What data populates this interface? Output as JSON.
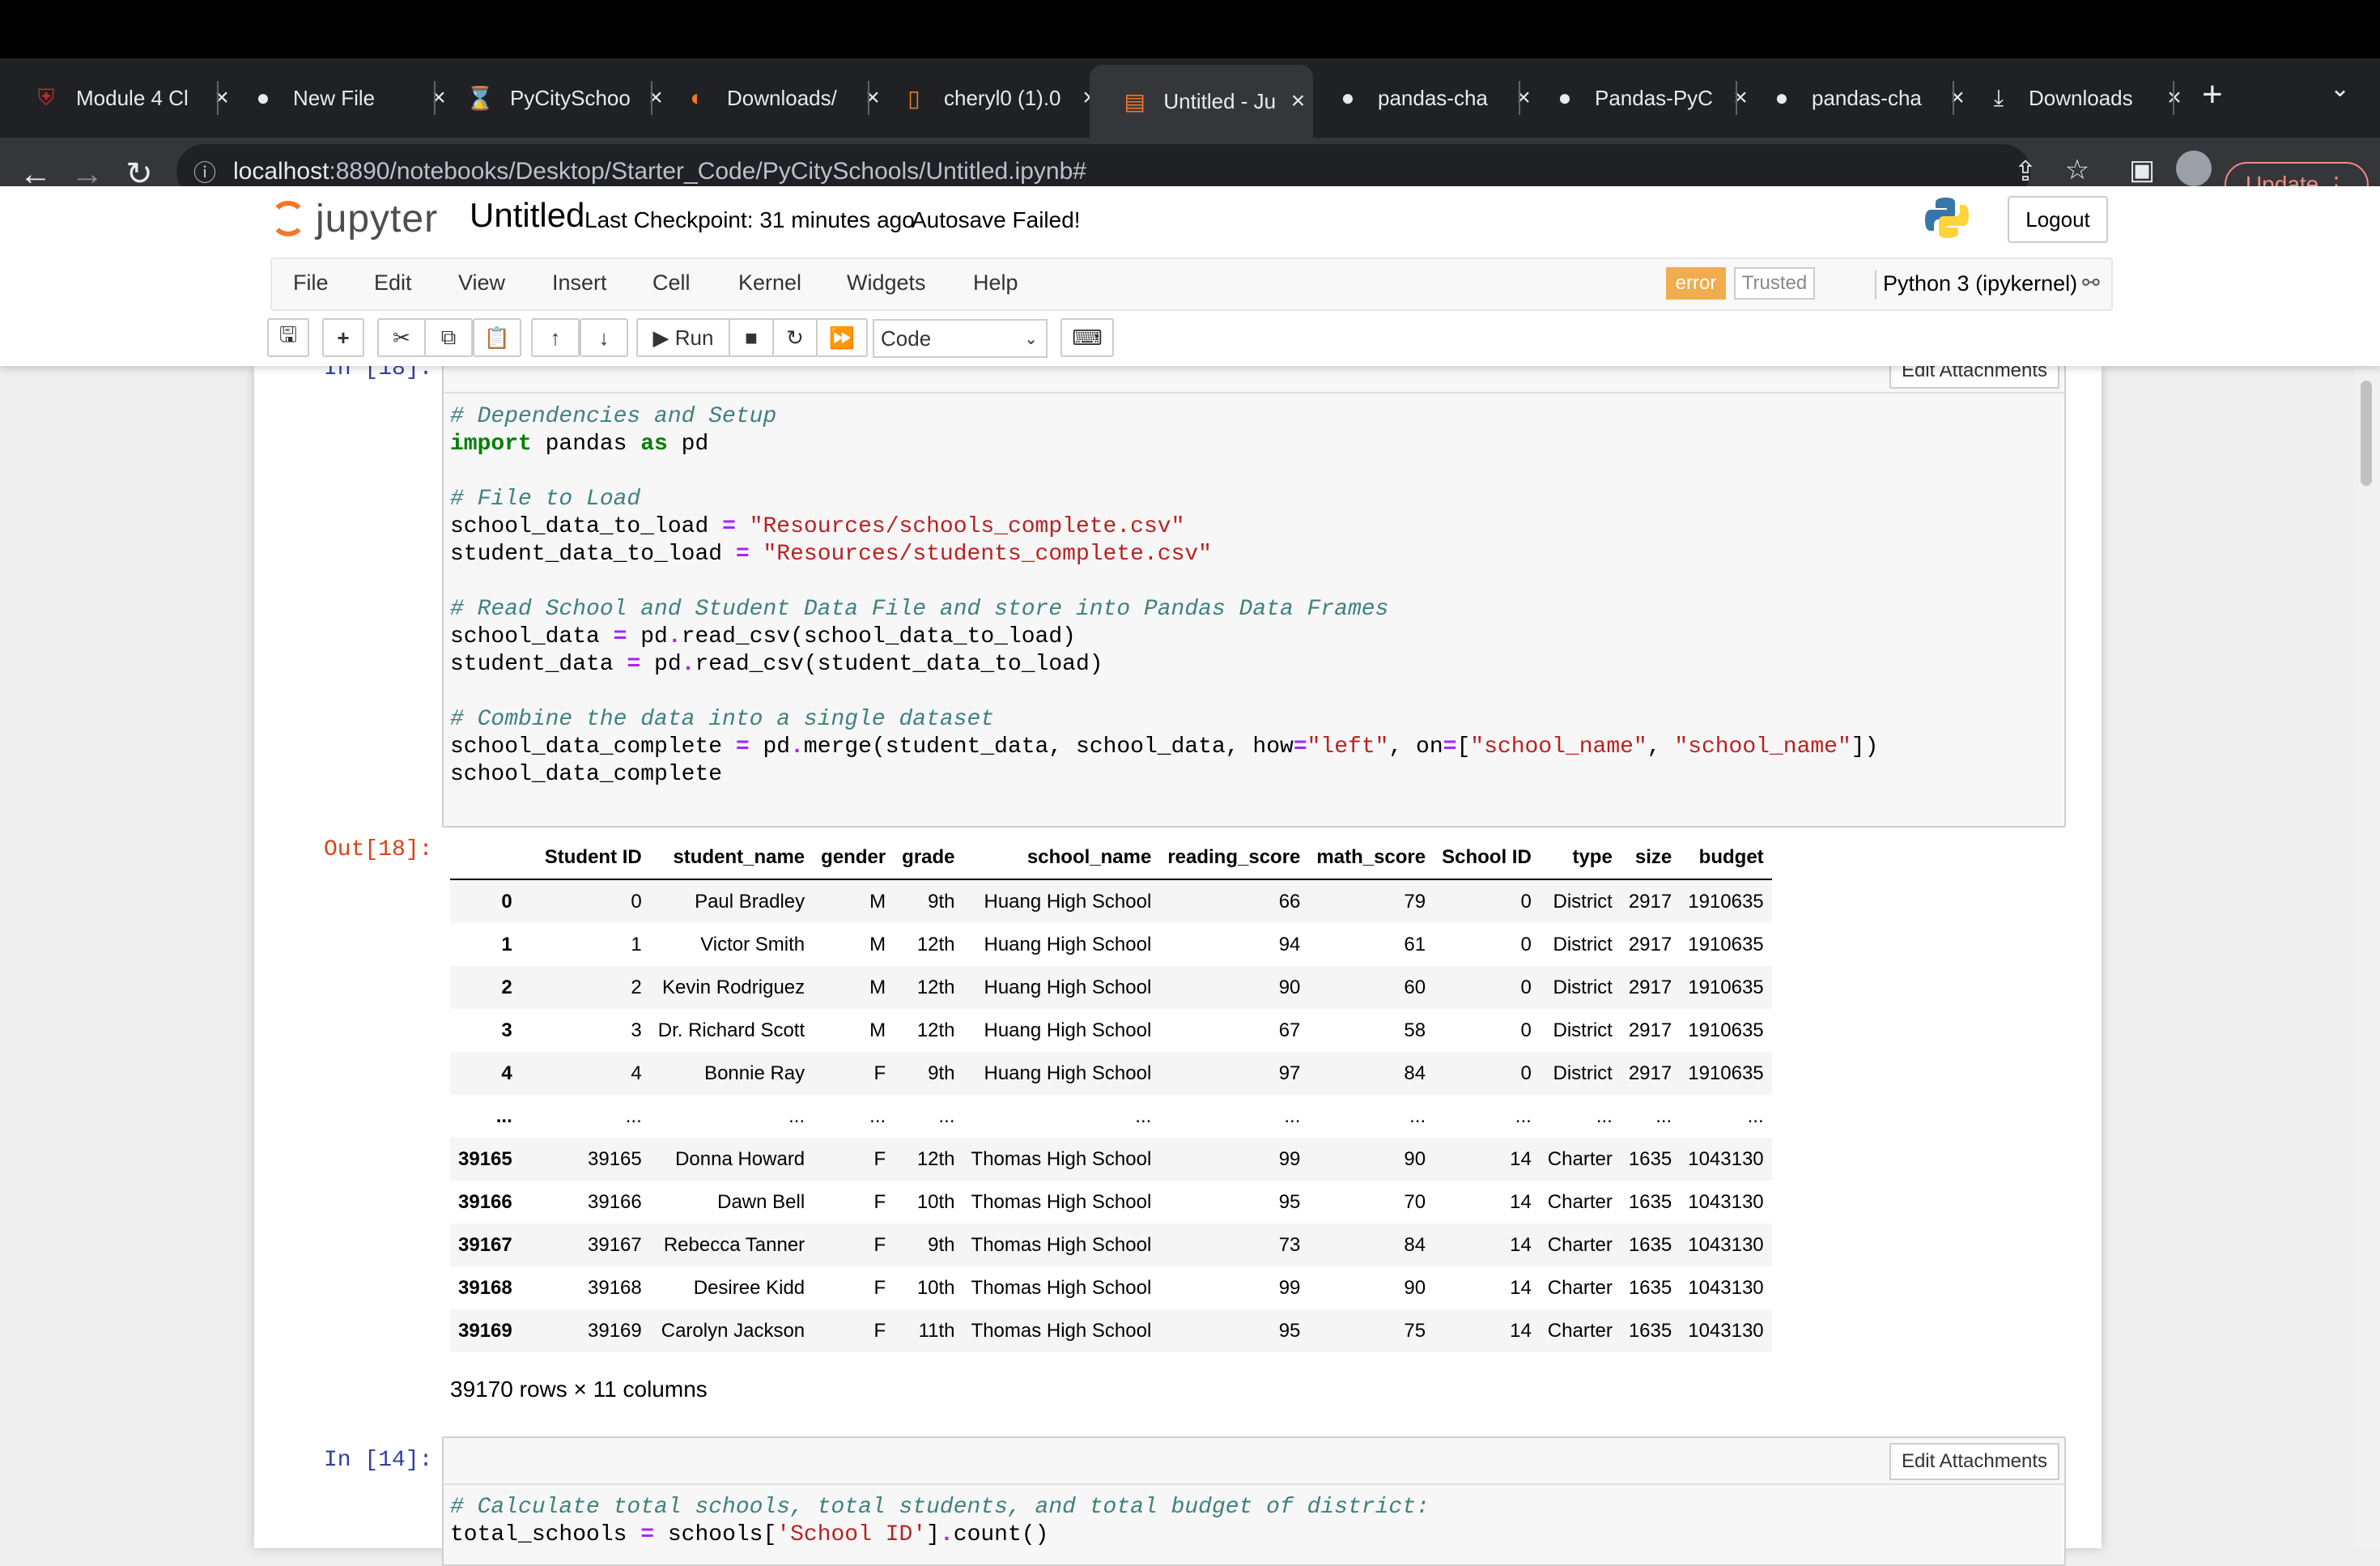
{
  "browser": {
    "tabs": [
      {
        "title": "Module 4 Cl",
        "icon": "shield-icon"
      },
      {
        "title": "New File",
        "icon": "github-icon"
      },
      {
        "title": "PyCitySchoo",
        "icon": "hourglass-icon"
      },
      {
        "title": "Downloads/",
        "icon": "jupyter-icon"
      },
      {
        "title": "cheryl0 (1).0",
        "icon": "file-icon"
      },
      {
        "title": "Untitled - Ju",
        "icon": "notebook-icon"
      },
      {
        "title": "pandas-cha",
        "icon": "github-icon"
      },
      {
        "title": "Pandas-PyC",
        "icon": "github-icon"
      },
      {
        "title": "pandas-cha",
        "icon": "github-icon"
      },
      {
        "title": "Downloads",
        "icon": "download-icon"
      }
    ],
    "active_tab_index": 5,
    "url_host": "localhost",
    "url_rest": ":8890/notebooks/Desktop/Starter_Code/PyCitySchools/Untitled.ipynb#",
    "update_label": "Update"
  },
  "jupyter": {
    "logo_text": "jupyter",
    "title": "Untitled",
    "checkpoint": "Last Checkpoint: 31 minutes ago",
    "autosave": "Autosave Failed!",
    "logout_label": "Logout",
    "menu": [
      "File",
      "Edit",
      "View",
      "Insert",
      "Cell",
      "Kernel",
      "Widgets",
      "Help"
    ],
    "error_badge": "error",
    "trusted_label": "Trusted",
    "kernel_name": "Python 3 (ipykernel)",
    "run_label": "Run",
    "cell_type": "Code"
  },
  "cell1": {
    "prompt_in": "In [18]:",
    "edit_attachments": "Edit Attachments",
    "prompt_out": "Out[18]:",
    "shape_text": "39170 rows × 11 columns"
  },
  "dataframe": {
    "columns": [
      "",
      "Student ID",
      "student_name",
      "gender",
      "grade",
      "school_name",
      "reading_score",
      "math_score",
      "School ID",
      "type",
      "size",
      "budget"
    ],
    "rows": [
      [
        "0",
        "0",
        "Paul Bradley",
        "M",
        "9th",
        "Huang High School",
        "66",
        "79",
        "0",
        "District",
        "2917",
        "1910635"
      ],
      [
        "1",
        "1",
        "Victor Smith",
        "M",
        "12th",
        "Huang High School",
        "94",
        "61",
        "0",
        "District",
        "2917",
        "1910635"
      ],
      [
        "2",
        "2",
        "Kevin Rodriguez",
        "M",
        "12th",
        "Huang High School",
        "90",
        "60",
        "0",
        "District",
        "2917",
        "1910635"
      ],
      [
        "3",
        "3",
        "Dr. Richard Scott",
        "M",
        "12th",
        "Huang High School",
        "67",
        "58",
        "0",
        "District",
        "2917",
        "1910635"
      ],
      [
        "4",
        "4",
        "Bonnie Ray",
        "F",
        "9th",
        "Huang High School",
        "97",
        "84",
        "0",
        "District",
        "2917",
        "1910635"
      ],
      [
        "...",
        "...",
        "...",
        "...",
        "...",
        "...",
        "...",
        "...",
        "...",
        "...",
        "...",
        "..."
      ],
      [
        "39165",
        "39165",
        "Donna Howard",
        "F",
        "12th",
        "Thomas High School",
        "99",
        "90",
        "14",
        "Charter",
        "1635",
        "1043130"
      ],
      [
        "39166",
        "39166",
        "Dawn Bell",
        "F",
        "10th",
        "Thomas High School",
        "95",
        "70",
        "14",
        "Charter",
        "1635",
        "1043130"
      ],
      [
        "39167",
        "39167",
        "Rebecca Tanner",
        "F",
        "9th",
        "Thomas High School",
        "73",
        "84",
        "14",
        "Charter",
        "1635",
        "1043130"
      ],
      [
        "39168",
        "39168",
        "Desiree Kidd",
        "F",
        "10th",
        "Thomas High School",
        "99",
        "90",
        "14",
        "Charter",
        "1635",
        "1043130"
      ],
      [
        "39169",
        "39169",
        "Carolyn Jackson",
        "F",
        "11th",
        "Thomas High School",
        "95",
        "75",
        "14",
        "Charter",
        "1635",
        "1043130"
      ]
    ]
  },
  "cell2": {
    "prompt_in": "In [14]:",
    "edit_attachments": "Edit Attachments",
    "code_comment": "# Calculate total schools, total students, and total budget of district:"
  }
}
